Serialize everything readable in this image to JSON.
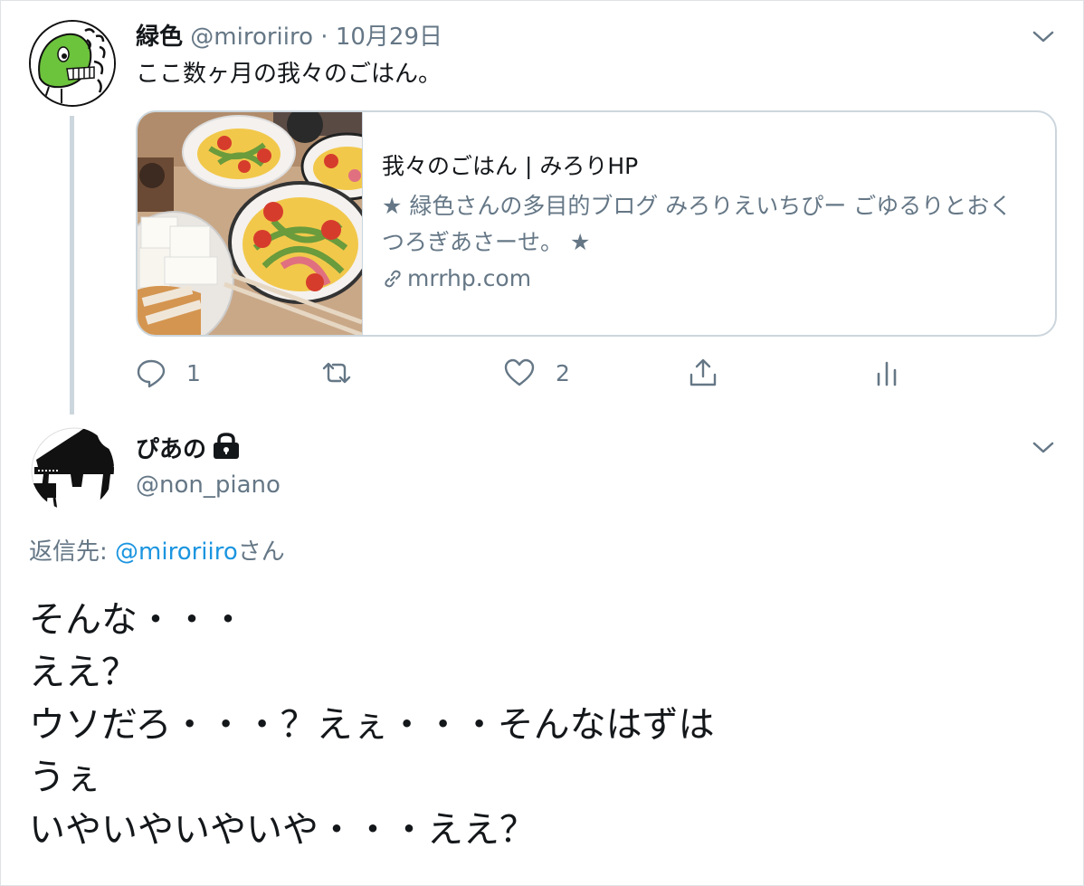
{
  "tweet": {
    "author_name": "緑色",
    "author_handle": "@miroriiro",
    "separator": "·",
    "date": "10月29日",
    "text": "ここ数ヶ月の我々のごはん。",
    "card": {
      "title": "我々のごはん | みろりHP",
      "description": "★ 緑色さんの多目的ブログ みろりえいちぴー ごゆるりとおくつろぎあさーせ。 ★",
      "domain": "mrrhp.com"
    },
    "actions": {
      "reply_count": "1",
      "retweet_count": "",
      "like_count": "2"
    }
  },
  "reply": {
    "author_name": "ぴあの",
    "author_handle": "@non_piano",
    "replying_prefix": "返信先: ",
    "replying_mention": "@miroriiro",
    "replying_suffix": "さん",
    "lines": [
      "そんな・・・",
      "ええ？",
      "ウソだろ・・・？えぇ・・・そんなはずは",
      "うぇ",
      "いやいやいやいや・・・ええ？"
    ]
  },
  "colors": {
    "text": "#14171a",
    "muted": "#657786",
    "link": "#1b95e0",
    "border": "#ccd6dd",
    "avatar_green": "#6cc33c"
  },
  "icons": [
    "chevron-down-icon",
    "link-icon",
    "reply-icon",
    "retweet-icon",
    "heart-icon",
    "share-icon",
    "analytics-icon",
    "lock-icon"
  ]
}
